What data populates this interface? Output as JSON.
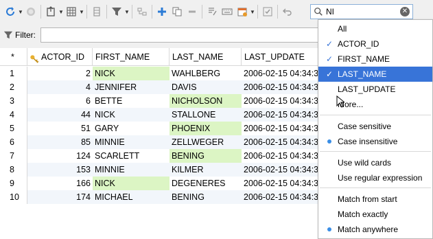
{
  "search": {
    "value": "NI",
    "clear_label": "✕"
  },
  "filter": {
    "label": "Filter:",
    "value": ""
  },
  "grid": {
    "corner": "*",
    "columns": [
      "ACTOR_ID",
      "FIRST_NAME",
      "LAST_NAME",
      "LAST_UPDATE"
    ],
    "rows": [
      {
        "n": "1",
        "id": "2",
        "first": "NICK",
        "last": "WAHLBERG",
        "upd": "2006-02-15 04:34:3",
        "hf": true,
        "hl": false
      },
      {
        "n": "2",
        "id": "4",
        "first": "JENNIFER",
        "last": "DAVIS",
        "upd": "2006-02-15 04:34:3",
        "hf": true,
        "hl": false
      },
      {
        "n": "3",
        "id": "6",
        "first": "BETTE",
        "last": "NICHOLSON",
        "upd": "2006-02-15 04:34:3",
        "hf": false,
        "hl": true
      },
      {
        "n": "4",
        "id": "44",
        "first": "NICK",
        "last": "STALLONE",
        "upd": "2006-02-15 04:34:3",
        "hf": true,
        "hl": false
      },
      {
        "n": "5",
        "id": "51",
        "first": "GARY",
        "last": "PHOENIX",
        "upd": "2006-02-15 04:34:3",
        "hf": false,
        "hl": true
      },
      {
        "n": "6",
        "id": "85",
        "first": "MINNIE",
        "last": "ZELLWEGER",
        "upd": "2006-02-15 04:34:3",
        "hf": true,
        "hl": false
      },
      {
        "n": "7",
        "id": "124",
        "first": "SCARLETT",
        "last": "BENING",
        "upd": "2006-02-15 04:34:3",
        "hf": false,
        "hl": true
      },
      {
        "n": "8",
        "id": "153",
        "first": "MINNIE",
        "last": "KILMER",
        "upd": "2006-02-15 04:34:3",
        "hf": true,
        "hl": false
      },
      {
        "n": "9",
        "id": "166",
        "first": "NICK",
        "last": "DEGENERES",
        "upd": "2006-02-15 04:34:3",
        "hf": true,
        "hl": false
      },
      {
        "n": "10",
        "id": "174",
        "first": "MICHAEL",
        "last": "BENING",
        "upd": "2006-02-15 04:34:3",
        "hf": false,
        "hl": true
      }
    ]
  },
  "menu": {
    "all": "All",
    "actor_id": "ACTOR_ID",
    "first_name": "FIRST_NAME",
    "last_name": "LAST_NAME",
    "last_update": "LAST_UPDATE",
    "more": "More...",
    "case_sensitive": "Case sensitive",
    "case_insensitive": "Case insensitive",
    "wild_cards": "Use wild cards",
    "regex": "Use regular expression",
    "match_start": "Match from start",
    "match_exact": "Match exactly",
    "match_anywhere": "Match anywhere",
    "check": "✓"
  },
  "colors": {
    "highlight": "#dcf5c4",
    "selection": "#3874d8",
    "dot": "#3a8ee6"
  }
}
